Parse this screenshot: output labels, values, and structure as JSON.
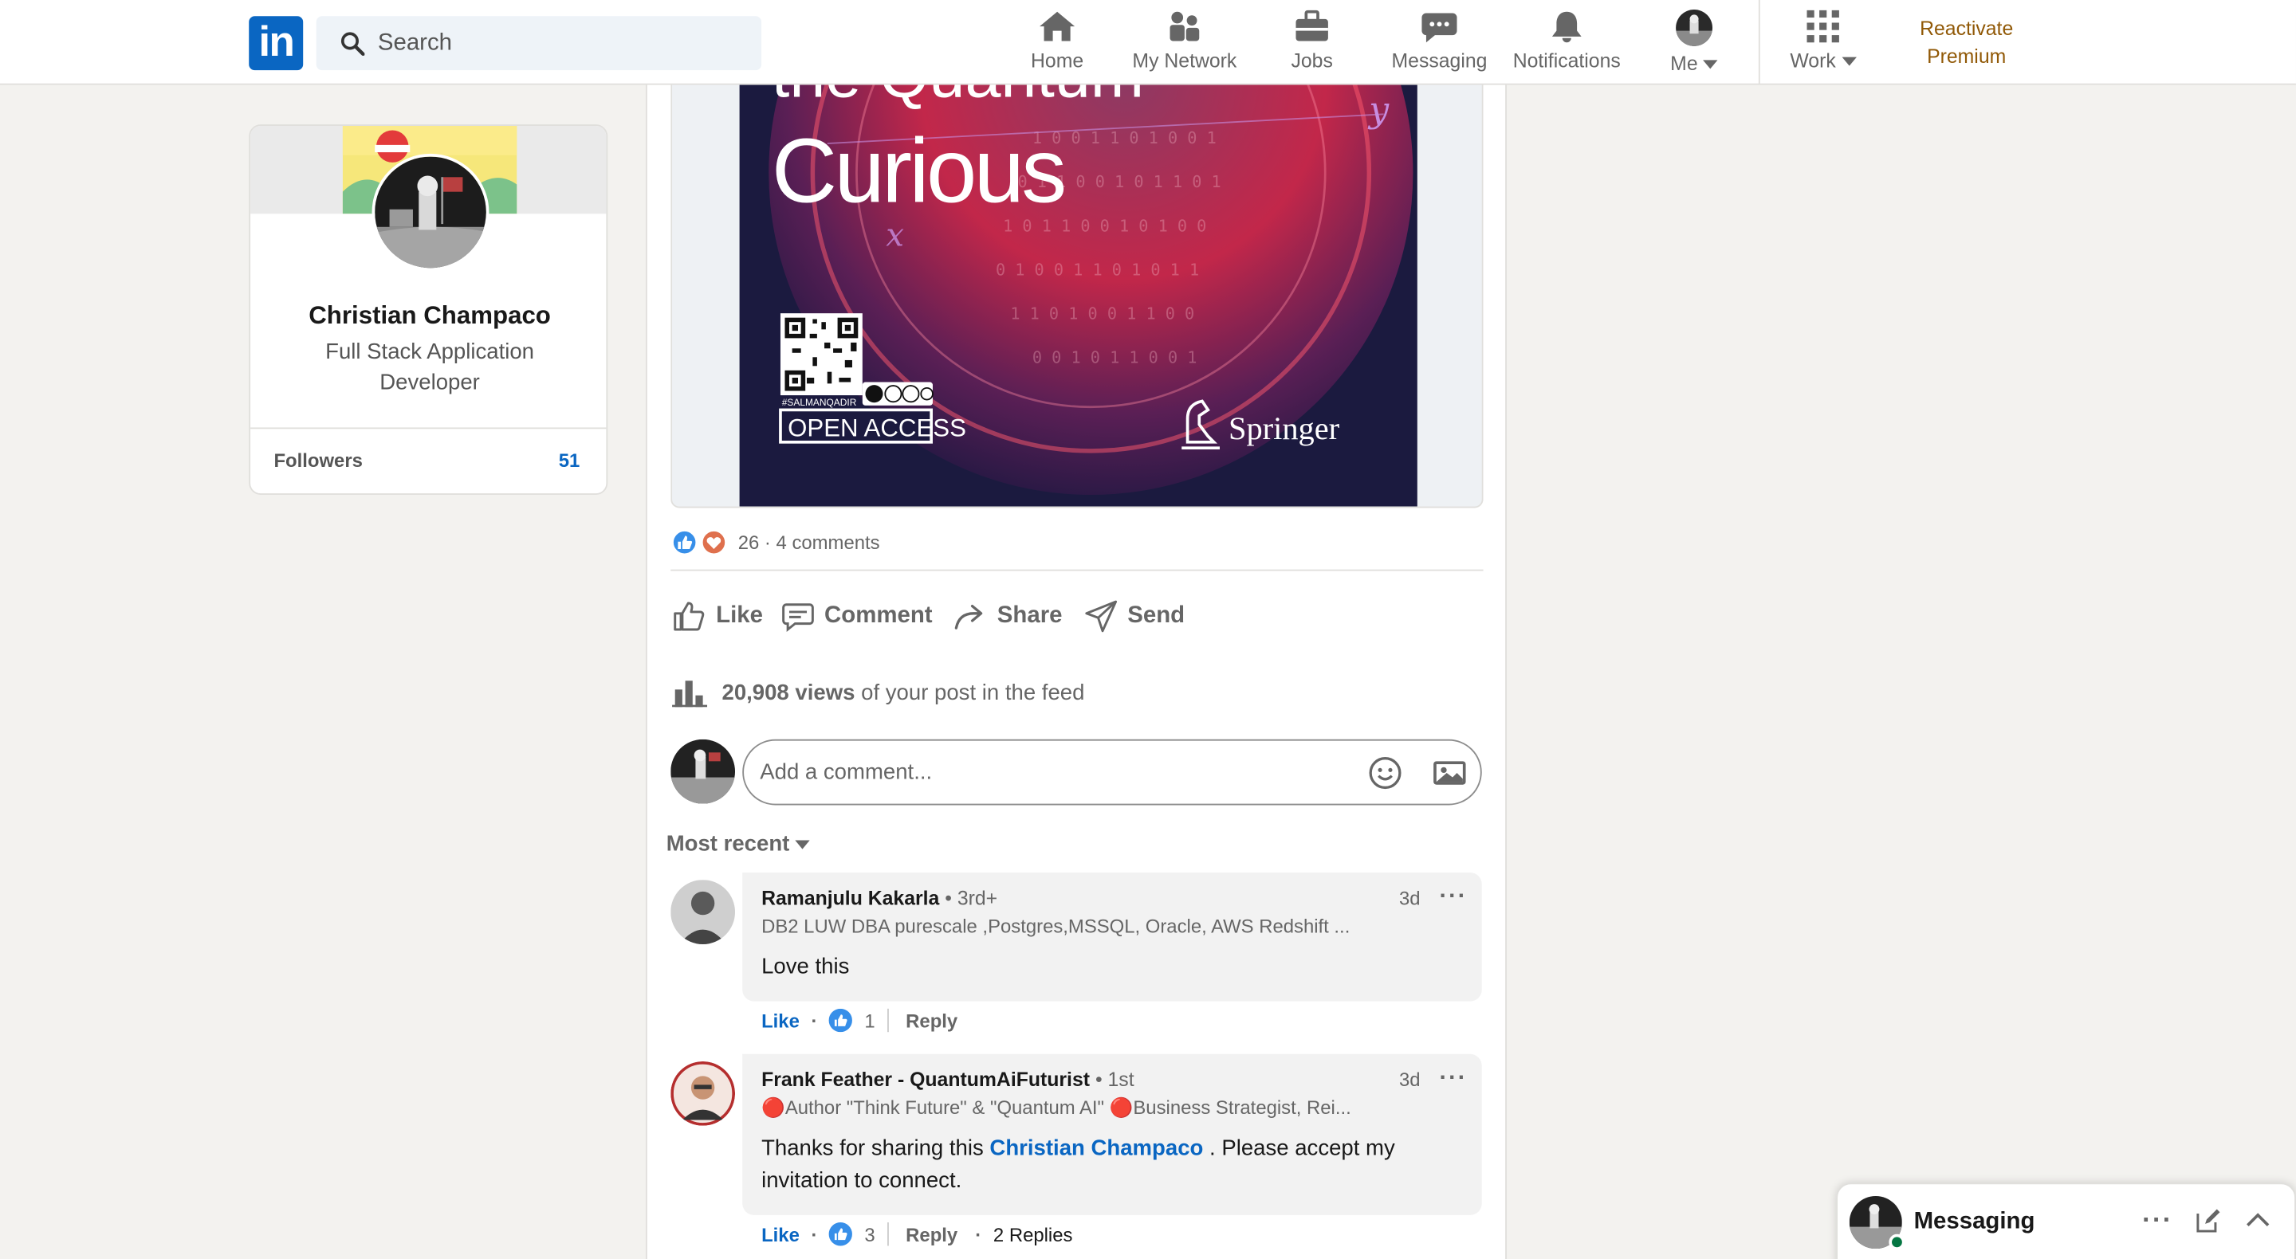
{
  "nav": {
    "search_placeholder": "Search",
    "items": [
      {
        "label": "Home"
      },
      {
        "label": "My Network"
      },
      {
        "label": "Jobs"
      },
      {
        "label": "Messaging"
      },
      {
        "label": "Notifications"
      },
      {
        "label": "Me"
      },
      {
        "label": "Work"
      }
    ],
    "premium_line1": "Reactivate",
    "premium_line2": "Premium",
    "colors": {
      "brand": "#0a66c2",
      "premium": "#915907"
    }
  },
  "profile": {
    "name": "Christian Champaco",
    "title": "Full Stack Application Developer",
    "followers_label": "Followers",
    "followers_count": "51"
  },
  "post": {
    "book": {
      "title_partial": "the Quantum",
      "title": "Curious",
      "qr_caption": "#SALMANQADIR",
      "badge": "OPEN ACCESS",
      "publisher": "Springer"
    },
    "reaction_count": "26",
    "comments_count": "4 comments",
    "actions": {
      "like": "Like",
      "comment": "Comment",
      "share": "Share",
      "send": "Send"
    },
    "views_number": "20,908 views",
    "views_suffix": "of your post in the feed",
    "comment_placeholder": "Add a comment...",
    "sort_label": "Most recent"
  },
  "comments": [
    {
      "name": "Ramanjulu Kakarla",
      "degree": "• 3rd+",
      "headline": "DB2 LUW DBA purescale ,Postgres,MSSQL, Oracle, AWS Redshift ...",
      "time": "3d",
      "text": "Love this",
      "like_label": "Like",
      "likes": "1",
      "reply_label": "Reply"
    },
    {
      "name": "Frank Feather - QuantumAiFuturist",
      "degree": "• 1st",
      "headline": "🔴Author \"Think Future\" & \"Quantum AI\" 🔴Business Strategist, Rei...",
      "time": "3d",
      "text_before": "Thanks for sharing this ",
      "mention": "Christian Champaco",
      "text_after": " . Please accept my invitation to connect.",
      "like_label": "Like",
      "likes": "3",
      "reply_label": "Reply",
      "replies": "2 Replies"
    }
  ],
  "messaging": {
    "label": "Messaging"
  }
}
